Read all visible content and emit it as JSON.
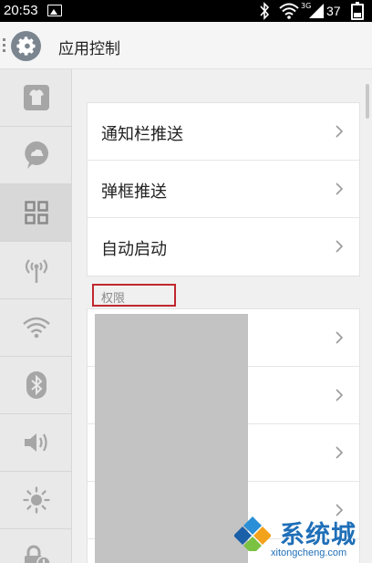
{
  "status_bar": {
    "time": "20:53",
    "network": "3G",
    "battery": "37",
    "battery_level_pct": 37
  },
  "header": {
    "title": "应用控制",
    "icon": "gear-icon"
  },
  "sidebar": {
    "items": [
      {
        "icon": "shirt-icon",
        "active": false
      },
      {
        "icon": "cloud-chat-icon",
        "active": false
      },
      {
        "icon": "grid-apps-icon",
        "active": true
      },
      {
        "icon": "antenna-icon",
        "active": false
      },
      {
        "icon": "wifi-icon",
        "active": false
      },
      {
        "icon": "bluetooth-icon",
        "active": false
      },
      {
        "icon": "volume-icon",
        "active": false
      },
      {
        "icon": "brightness-icon",
        "active": false
      },
      {
        "icon": "lock-icon",
        "active": false
      }
    ]
  },
  "main": {
    "menu": [
      {
        "label": "通知栏推送"
      },
      {
        "label": "弹框推送"
      },
      {
        "label": "自动启动"
      }
    ],
    "section_label": "权限",
    "permission_rows": 4
  },
  "watermark": {
    "text": "系统城",
    "url": "xitongcheng.com"
  },
  "colors": {
    "accent_highlight": "#c1272d",
    "watermark_blue": "#1f6fb8",
    "status_bar": "#000000"
  }
}
